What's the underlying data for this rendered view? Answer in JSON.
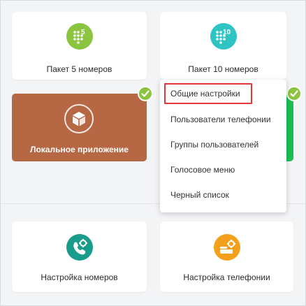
{
  "cards": {
    "pack5": {
      "label": "Пакет 5 номеров",
      "icon": "dialpad-5-icon",
      "badge": "5",
      "color": "#8bc53f"
    },
    "pack10": {
      "label": "Пакет 10 номеров",
      "icon": "dialpad-10-icon",
      "badge": "10",
      "color": "#2ec4c4"
    },
    "local_app": {
      "label": "Локальное приложение",
      "icon": "box-icon",
      "color": "#b66845",
      "checked": true
    },
    "numbers_settings": {
      "label": "Настройка номеров",
      "icon": "phone-gear-icon",
      "color": "#1a9c8c"
    },
    "telephony_settings": {
      "label": "Настройка телефонии",
      "icon": "switchboard-gear-icon",
      "color": "#f5a01a"
    }
  },
  "dropdown": {
    "items": [
      {
        "label": "Общие настройки",
        "highlighted": true
      },
      {
        "label": "Пользователи телефонии"
      },
      {
        "label": "Группы пользователей"
      },
      {
        "label": "Голосовое меню"
      },
      {
        "label": "Черный список"
      }
    ]
  },
  "colors": {
    "check": "#8bc53f",
    "highlight_border": "#e5373b",
    "green_card": "#1cbf52"
  }
}
